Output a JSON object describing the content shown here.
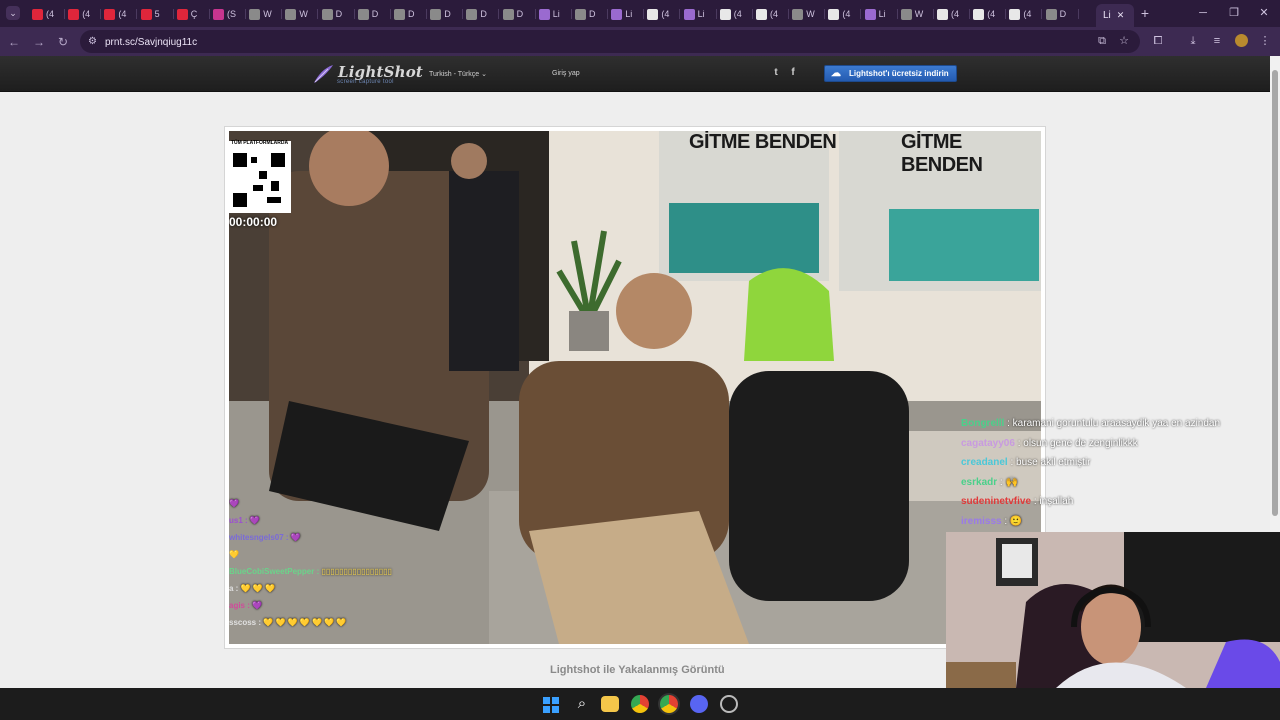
{
  "browser": {
    "tabs": [
      {
        "label": "(4",
        "color": "#e0263b"
      },
      {
        "label": "(4",
        "color": "#e0263b"
      },
      {
        "label": "(4",
        "color": "#e0263b"
      },
      {
        "label": "5",
        "color": "#e0263b"
      },
      {
        "label": "Ç",
        "color": "#e0263b"
      },
      {
        "label": "(S",
        "color": "#c8358f"
      },
      {
        "label": "W",
        "color": "#8a8a8a"
      },
      {
        "label": "W",
        "color": "#8a8a8a"
      },
      {
        "label": "D",
        "color": "#8a8a8a"
      },
      {
        "label": "D",
        "color": "#8a8a8a"
      },
      {
        "label": "D",
        "color": "#8a8a8a"
      },
      {
        "label": "D",
        "color": "#8a8a8a"
      },
      {
        "label": "D",
        "color": "#8a8a8a"
      },
      {
        "label": "D",
        "color": "#8a8a8a"
      },
      {
        "label": "Li",
        "color": "#9a6ad0"
      },
      {
        "label": "D",
        "color": "#8a8a8a"
      },
      {
        "label": "Li",
        "color": "#9a6ad0"
      },
      {
        "label": "(4",
        "color": "#e8e8e8"
      },
      {
        "label": "Li",
        "color": "#9a6ad0"
      },
      {
        "label": "(4",
        "color": "#e8e8e8"
      },
      {
        "label": "(4",
        "color": "#e8e8e8"
      },
      {
        "label": "W",
        "color": "#8a8a8a"
      },
      {
        "label": "(4",
        "color": "#e8e8e8"
      },
      {
        "label": "Li",
        "color": "#9a6ad0"
      },
      {
        "label": "W",
        "color": "#8a8a8a"
      },
      {
        "label": "(4",
        "color": "#e8e8e8"
      },
      {
        "label": "(4",
        "color": "#e8e8e8"
      },
      {
        "label": "(4",
        "color": "#e8e8e8"
      },
      {
        "label": "D",
        "color": "#8a8a8a"
      }
    ],
    "active_tab": {
      "label": "Li",
      "close": "✕"
    },
    "new_tab": "+",
    "url": "prnt.sc/Savjnqiug11c"
  },
  "lightshot": {
    "logo": "LightShot",
    "tagline": "screen capture tool",
    "language": "Turkish - Türkçe",
    "login": "Giriş yap",
    "twitter": "t",
    "facebook": "f",
    "download": "Lightshot'ı ücretsiz indirin",
    "caption": "Lightshot ile Yakalanmış Görüntü"
  },
  "screenshot": {
    "qr_caption": "TÜM PLATFORMLARDA",
    "timer": "00:00:00",
    "banner_left": "GİTME BENDEN",
    "banner_right": "GİTME BENDEN",
    "chat_left": [
      {
        "user": "",
        "msg": "💜",
        "color": "#c84ad0"
      },
      {
        "user": "us1 :",
        "msg": "💜",
        "color": "#9c4fd0"
      },
      {
        "user": "whitesngels07 :",
        "msg": "💜",
        "color": "#7a6ad8"
      },
      {
        "user": "💛",
        "msg": "",
        "color": "#ffd84a"
      },
      {
        "user": "BlueCobiSweetPepper :",
        "msg": "▯▯▯▯▯▯▯▯▯▯▯▯▯▯▯▯",
        "color": "#6ad48a"
      },
      {
        "user": "a :",
        "msg": "💛 💛 💛",
        "color": "#e0e0e0"
      },
      {
        "user": "agis :",
        "msg": "💜",
        "color": "#d04a9a"
      },
      {
        "user": "sscoss :",
        "msg": "💛 💛 💛 💛 💛 💛 💛",
        "color": "#e0e0e0"
      }
    ]
  },
  "stream_chat": [
    {
      "user": "Bongrelll",
      "msg": ": karamani goruntulu araasaydik yaa en azindan",
      "color": "#4ad08a"
    },
    {
      "user": "cagatayy06",
      "msg": ": olsun gene de zenginlikkk",
      "color": "#c89ae0"
    },
    {
      "user": "creadanel",
      "msg": ": buse akil etmiştir",
      "color": "#4ac8d8"
    },
    {
      "user": "esrkadr",
      "msg": ": 🙌",
      "color": "#4ad08a"
    },
    {
      "user": "sudeninetvfive",
      "msg": ": inşallah",
      "color": "#e03a3a"
    },
    {
      "user": "iremisss",
      "msg": ": 🙂",
      "color": "#9a7ae8"
    }
  ],
  "colors": {
    "browser_frame": "#2b1b3b",
    "lightshot_header": "#242424",
    "download_button": "#2f6cc4",
    "page_bg": "#eeeeee"
  }
}
